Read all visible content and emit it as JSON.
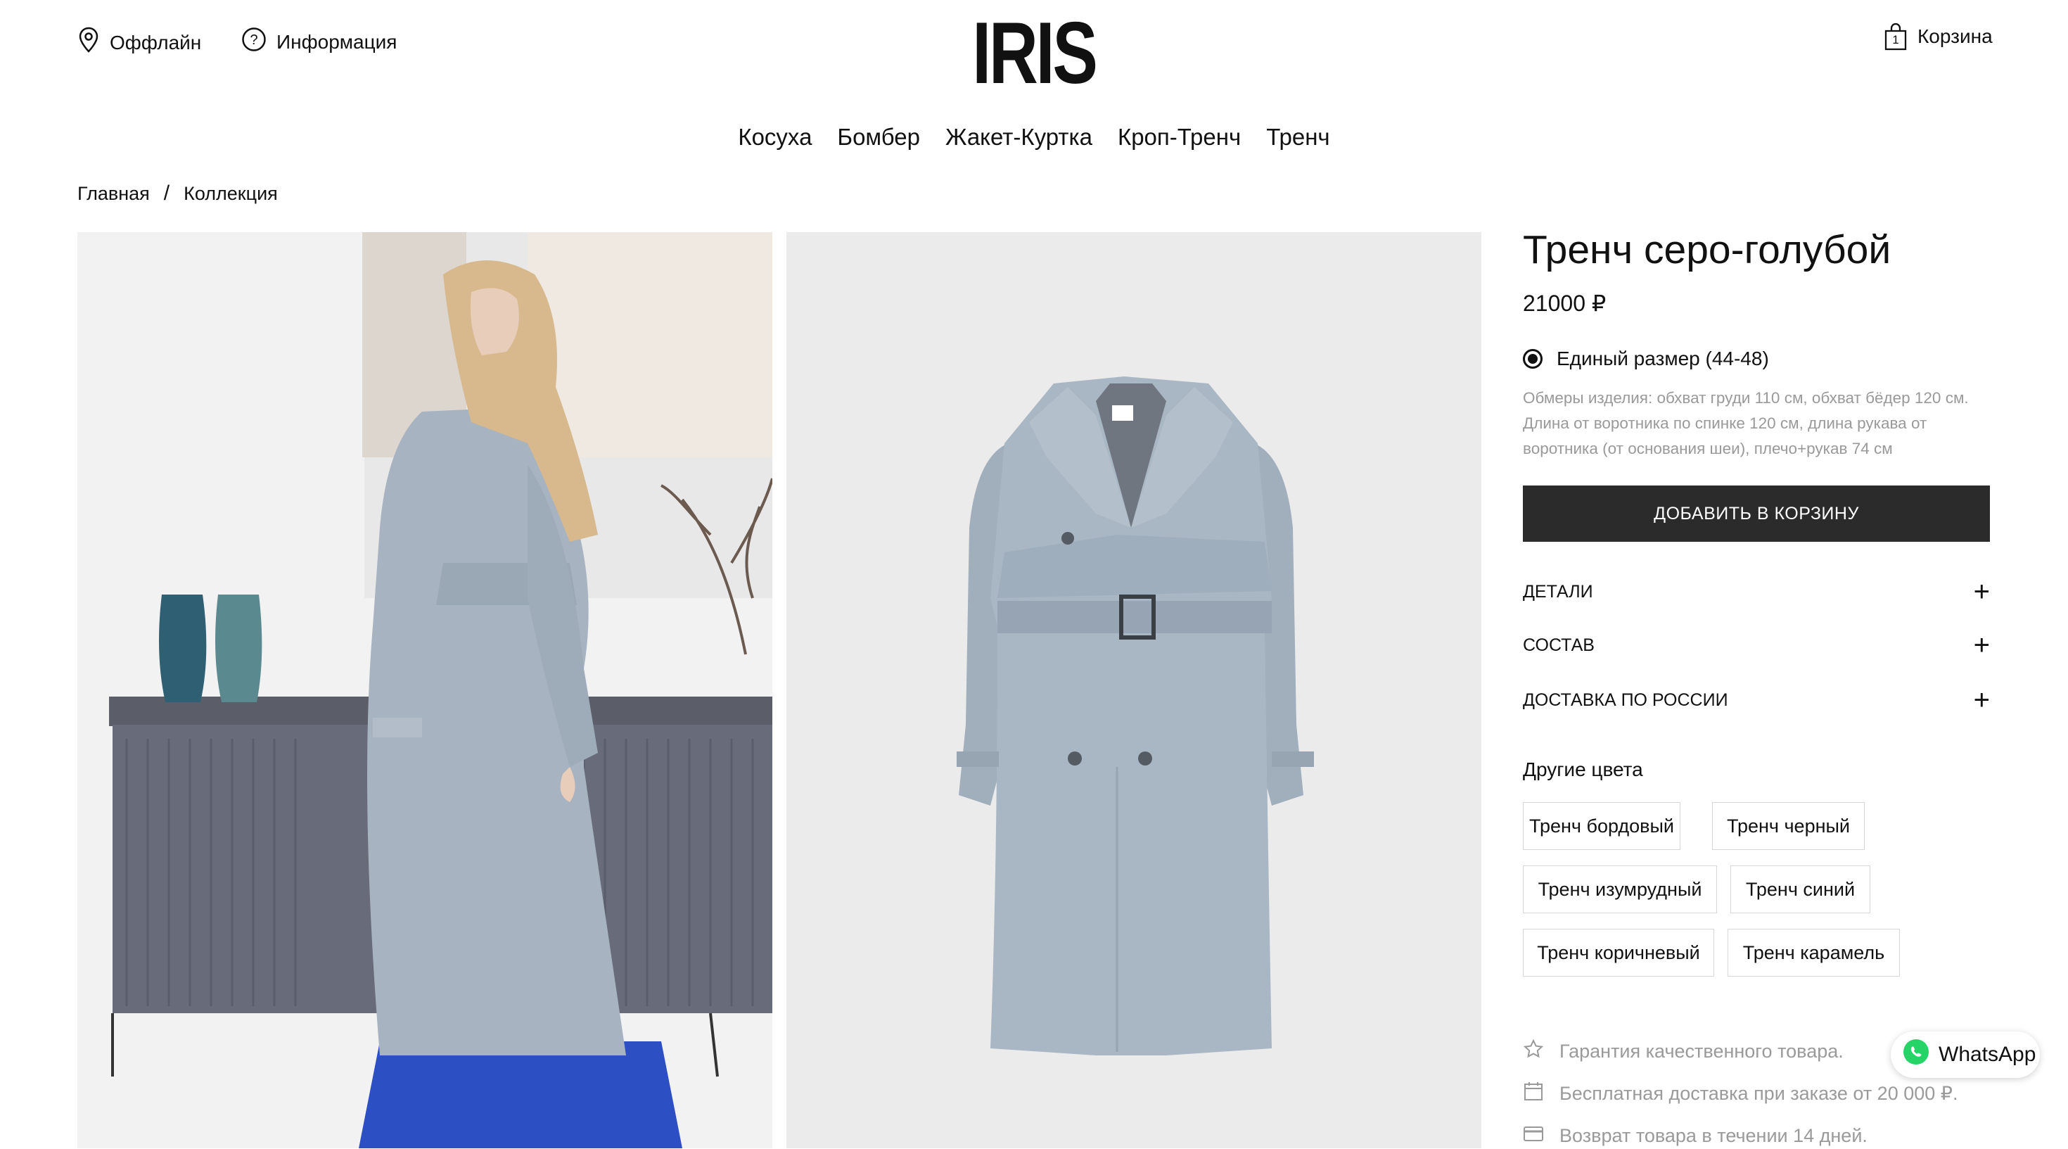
{
  "header": {
    "offline_label": "Оффлайн",
    "info_label": "Информация",
    "logo_text": "IRIS",
    "cart_label": "Корзина",
    "cart_count": "1"
  },
  "nav": {
    "items": [
      {
        "label": "Косуха"
      },
      {
        "label": "Бомбер"
      },
      {
        "label": "Жакет-Куртка"
      },
      {
        "label": "Кроп-Тренч"
      },
      {
        "label": "Тренч"
      }
    ]
  },
  "breadcrumb": {
    "home": "Главная",
    "separator": "/",
    "current": "Коллекция"
  },
  "product": {
    "title": "Тренч серо-голубой",
    "price": "21000 ₽",
    "size_option": "Единый размер (44-48)",
    "measurements": "Обмеры изделия: обхват груди 110 см, обхват бёдер 120 см. Длина от воротника по спинке 120 см, длина рукава от воротника (от основания шеи), плечо+рукав 74 см",
    "add_to_cart": "ДОБАВИТЬ В КОРЗИНУ",
    "coat_color": "#a9b6c3"
  },
  "accordion": [
    {
      "label": "ДЕТАЛИ"
    },
    {
      "label": "СОСТАВ"
    },
    {
      "label": "ДОСТАВКА ПО РОССИИ"
    }
  ],
  "other_colors": {
    "title": "Другие цвета",
    "items": [
      {
        "label": "Тренч бордовый"
      },
      {
        "label": "Тренч черный"
      },
      {
        "label": "Тренч изумрудный"
      },
      {
        "label": "Тренч синий"
      },
      {
        "label": "Тренч коричневый"
      },
      {
        "label": "Тренч карамель"
      }
    ]
  },
  "features": [
    {
      "icon": "star-icon",
      "text": "Гарантия качественного товара."
    },
    {
      "icon": "calendar-icon",
      "text": "Бесплатная доставка при заказе от 20 000 ₽."
    },
    {
      "icon": "card-icon",
      "text": "Возврат товара в течении 14 дней."
    }
  ],
  "whatsapp": {
    "label": "WhatsApp",
    "color": "#25d366"
  }
}
